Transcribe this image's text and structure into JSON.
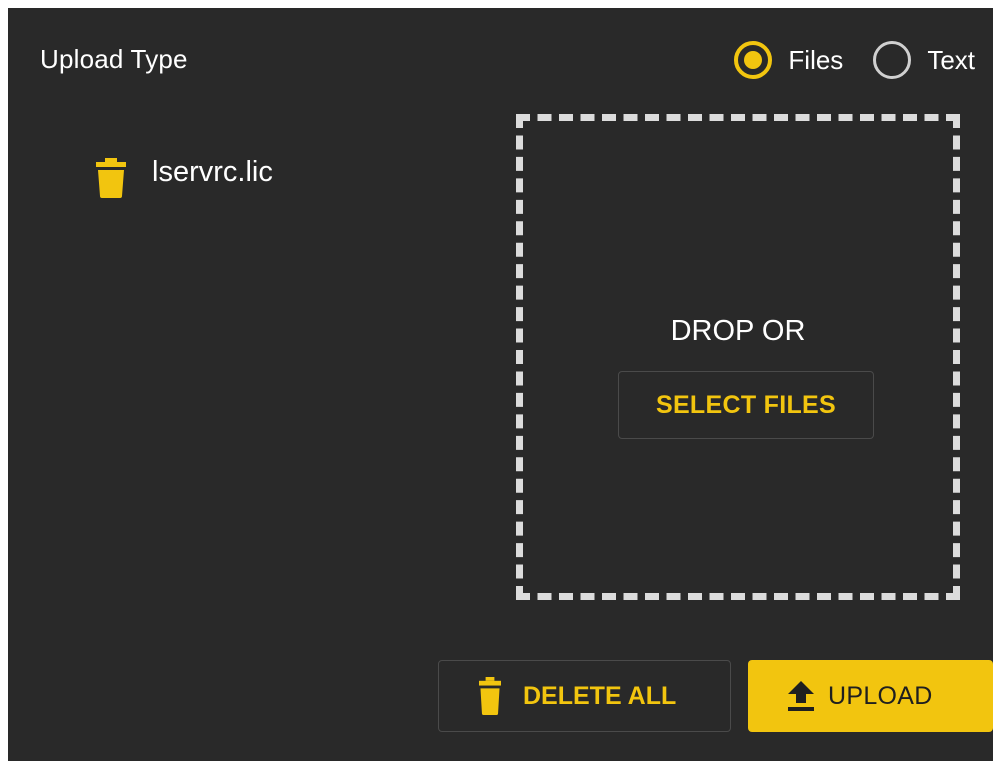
{
  "header": {
    "title": "Upload Type"
  },
  "upload_type": {
    "options": [
      {
        "label": "Files",
        "selected": true
      },
      {
        "label": "Text",
        "selected": false
      }
    ]
  },
  "files": [
    {
      "name": "lservrc.lic",
      "icon": "trash-icon"
    }
  ],
  "drop_zone": {
    "prompt": "DROP OR",
    "select_label": "SELECT FILES"
  },
  "actions": {
    "delete_all_label": "DELETE ALL",
    "delete_all_icon": "trash-icon",
    "upload_label": "UPLOAD",
    "upload_icon": "upload-arrow-icon"
  },
  "colors": {
    "background": "#292929",
    "accent": "#f2c50f",
    "text": "#ffffff",
    "dashed_border": "#dcdcdc"
  }
}
